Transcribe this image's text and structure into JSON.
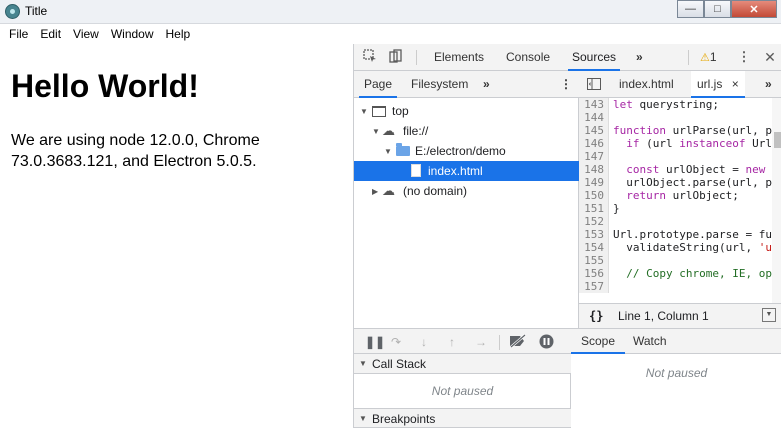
{
  "window": {
    "title": "Title"
  },
  "menu": [
    "File",
    "Edit",
    "View",
    "Window",
    "Help"
  ],
  "page": {
    "heading": "Hello World!",
    "text": "We are using node 12.0.0, Chrome 73.0.3683.121, and Electron 5.0.5."
  },
  "devtools": {
    "tabs": [
      "Elements",
      "Console",
      "Sources"
    ],
    "active_tab": "Sources",
    "more": "»",
    "warning_count": "1",
    "kebab": "⋮",
    "close": "✕"
  },
  "navigator": {
    "tabs": [
      "Page",
      "Filesystem"
    ],
    "more": "»",
    "kebab": "⋮",
    "tree": [
      {
        "label": "top"
      },
      {
        "label": "file://"
      },
      {
        "label": "E:/electron/demo"
      },
      {
        "label": "index.html"
      },
      {
        "label": "(no domain)"
      }
    ]
  },
  "editor": {
    "tabs": [
      "index.html",
      "url.js"
    ],
    "close_glyph": "×",
    "more": "»",
    "lines": [
      {
        "n": "143",
        "t": "let querystring;"
      },
      {
        "n": "144",
        "t": ""
      },
      {
        "n": "145",
        "t": "function urlParse(url, p"
      },
      {
        "n": "146",
        "t": "  if (url instanceof Url"
      },
      {
        "n": "147",
        "t": ""
      },
      {
        "n": "148",
        "t": "  const urlObject = new"
      },
      {
        "n": "149",
        "t": "  urlObject.parse(url, p"
      },
      {
        "n": "150",
        "t": "  return urlObject;"
      },
      {
        "n": "151",
        "t": "}"
      },
      {
        "n": "152",
        "t": ""
      },
      {
        "n": "153",
        "t": "Url.prototype.parse = fu"
      },
      {
        "n": "154",
        "t": "  validateString(url, 'u"
      },
      {
        "n": "155",
        "t": ""
      },
      {
        "n": "156",
        "t": "  // Copy chrome, IE, op"
      },
      {
        "n": "157",
        "t": ""
      }
    ],
    "status": "Line 1, Column 1",
    "format_glyph": "{}"
  },
  "debugger": {
    "sections": [
      {
        "title": "Call Stack",
        "body": "Not paused"
      },
      {
        "title": "Breakpoints",
        "body": ""
      }
    ],
    "right_tabs": [
      "Scope",
      "Watch"
    ],
    "right_body": "Not paused"
  }
}
